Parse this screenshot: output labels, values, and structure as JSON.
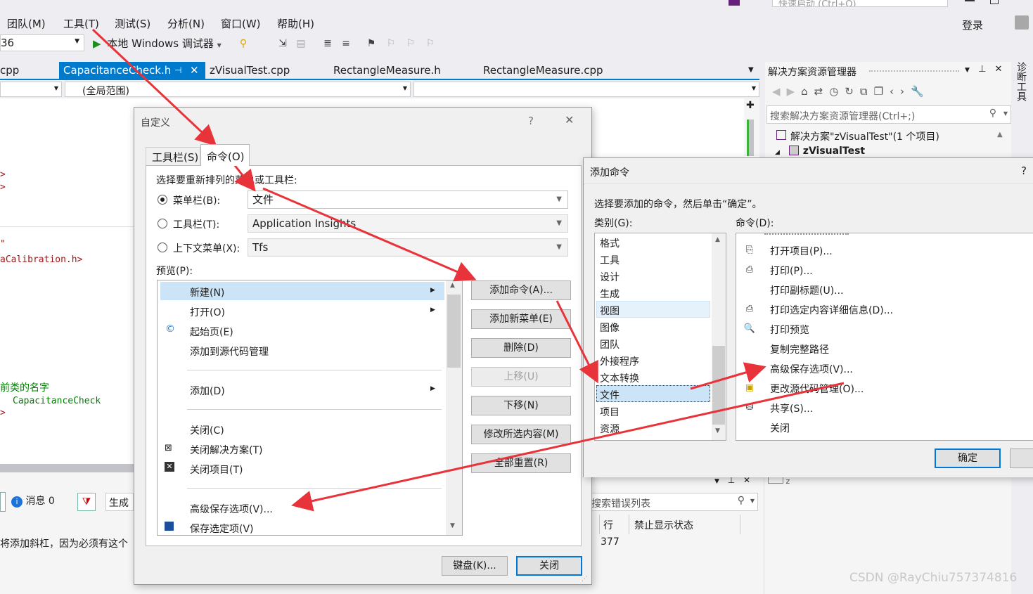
{
  "menu": [
    "团队(M)",
    "工具(T)",
    "测试(S)",
    "分析(N)",
    "窗口(W)",
    "帮助(H)"
  ],
  "quick_launch_placeholder": "快速启动 (Ctrl+Q)",
  "login": "登录",
  "toolbar": {
    "config_value": "36",
    "debugger": "本地 Windows 调试器"
  },
  "doc_tabs": [
    "cpp",
    "CapacitanceCheck.h",
    "zVisualTest.cpp",
    "RectangleMeasure.h",
    "RectangleMeasure.cpp"
  ],
  "scope_combo": "(全局范围)",
  "code_snippets": {
    "l1": "\"",
    "l2": "aCalibration.h>",
    "l3": "前类的名字",
    "l4": "CapacitanceCheck",
    "gt1": ">",
    "gt2": ">",
    "gt3": ">"
  },
  "errors": {
    "messages": "消息 0",
    "build": "生成",
    "search": "搜索错误列表",
    "col_line": "行",
    "col_suppress": "禁止显示状态",
    "row_text": "将添加斜杠，因为必须有这个",
    "row_line": "377"
  },
  "solution_explorer": {
    "title": "解决方案资源管理器",
    "search": "搜索解决方案资源管理器(Ctrl+;)",
    "solution": "解决方案\"zVisualTest\"(1 个项目)",
    "project": "zVisualTest"
  },
  "side_label": "诊断工具",
  "customize": {
    "title": "自定义",
    "help": "?",
    "tabs": [
      "工具栏(S)",
      "命令(O)"
    ],
    "choose_label": "选择要重新排列的菜单或工具栏:",
    "menubar_label": "菜单栏(B):",
    "menubar_value": "文件",
    "toolbar_label": "工具栏(T):",
    "toolbar_value": "Application Insights",
    "context_label": "上下文菜单(X):",
    "context_value": "Tfs",
    "preview_label": "预览(P):",
    "preview_items": [
      "新建(N)",
      "打开(O)",
      "起始页(E)",
      "添加到源代码管理",
      "添加(D)",
      "关闭(C)",
      "关闭解决方案(T)",
      "关闭项目(T)",
      "高级保存选项(V)...",
      "保存选定项(V)"
    ],
    "buttons": [
      "添加命令(A)...",
      "添加新菜单(E)",
      "删除(D)",
      "上移(U)",
      "下移(N)",
      "修改所选内容(M)",
      "全部重置(R)"
    ],
    "keyboard": "键盘(K)...",
    "close": "关闭"
  },
  "add_command": {
    "title": "添加命令",
    "help": "?",
    "instruction": "选择要添加的命令，然后单击“确定”。",
    "categories_label": "类别(G):",
    "commands_label": "命令(D):",
    "categories": [
      "格式",
      "工具",
      "设计",
      "生成",
      "视图",
      "图像",
      "团队",
      "外接程序",
      "文本转换",
      "文件",
      "项目",
      "资源"
    ],
    "commands": [
      "打开项目(P)...",
      "打印(P)...",
      "打印副标题(U)...",
      "打印选定内容详细信息(D)...",
      "打印预览",
      "复制完整路径",
      "高级保存选项(V)...",
      "更改源代码管理(O)...",
      "共享(S)...",
      "关闭"
    ],
    "ok": "确定"
  },
  "watermark": "CSDN @RayChiu757374816",
  "colors": {
    "accent": "#007acc",
    "arrow": "#e8333a",
    "selection": "#cce4f7"
  }
}
